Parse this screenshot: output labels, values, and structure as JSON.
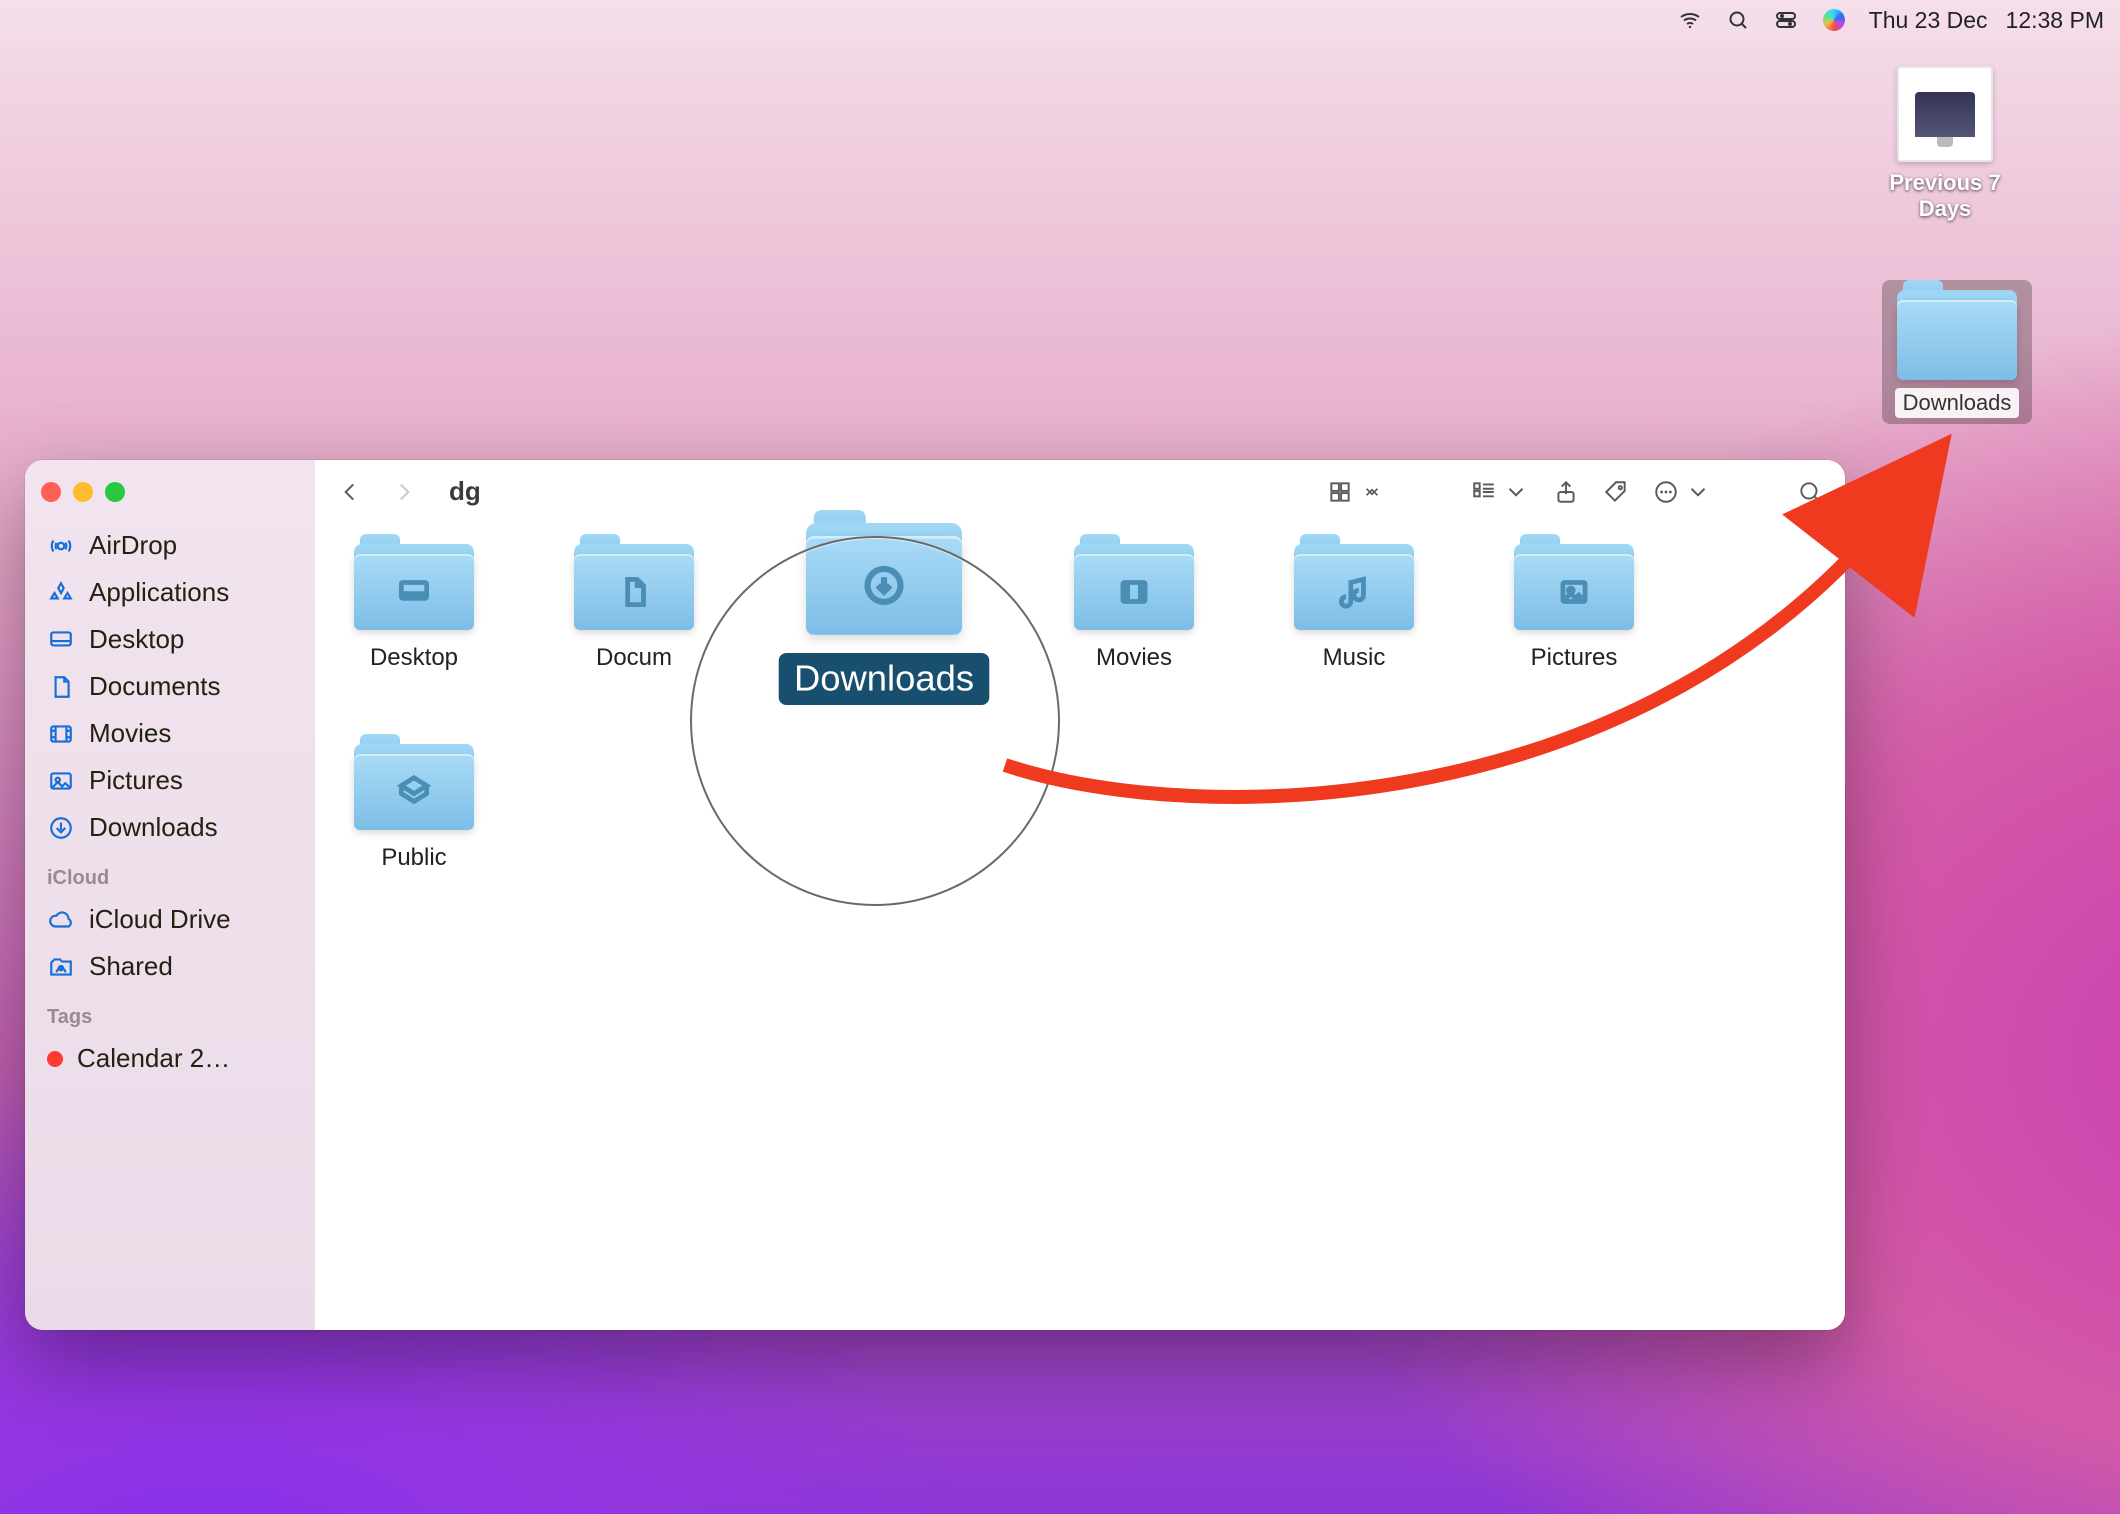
{
  "menubar": {
    "date": "Thu 23 Dec",
    "time": "12:38 PM"
  },
  "desktop": {
    "item_prev7": "Previous 7 Days",
    "item_downloads": "Downloads"
  },
  "finder": {
    "title": "dg",
    "sidebar": {
      "favorites": [
        {
          "key": "airdrop",
          "label": "AirDrop"
        },
        {
          "key": "applications",
          "label": "Applications"
        },
        {
          "key": "desktop",
          "label": "Desktop"
        },
        {
          "key": "documents",
          "label": "Documents"
        },
        {
          "key": "movies",
          "label": "Movies"
        },
        {
          "key": "pictures",
          "label": "Pictures"
        },
        {
          "key": "downloads",
          "label": "Downloads"
        }
      ],
      "icloud_title": "iCloud",
      "icloud": [
        {
          "key": "iclouddrive",
          "label": "iCloud Drive"
        },
        {
          "key": "shared",
          "label": "Shared"
        }
      ],
      "tags_title": "Tags",
      "tags": [
        {
          "key": "calendar",
          "label": "Calendar 2…",
          "color": "#ff3b30"
        }
      ]
    },
    "items": [
      {
        "key": "desktop",
        "label": "Desktop",
        "glyph": "desktop"
      },
      {
        "key": "documents",
        "label": "Docum",
        "glyph": "doc"
      },
      {
        "key": "downloads",
        "label": "Downloads",
        "glyph": "download",
        "selected": true
      },
      {
        "key": "movies",
        "label": "Movies",
        "glyph": "movie"
      },
      {
        "key": "music",
        "label": "Music",
        "glyph": "music"
      },
      {
        "key": "pictures",
        "label": "Pictures",
        "glyph": "pic"
      },
      {
        "key": "public",
        "label": "Public",
        "glyph": "public"
      }
    ]
  }
}
